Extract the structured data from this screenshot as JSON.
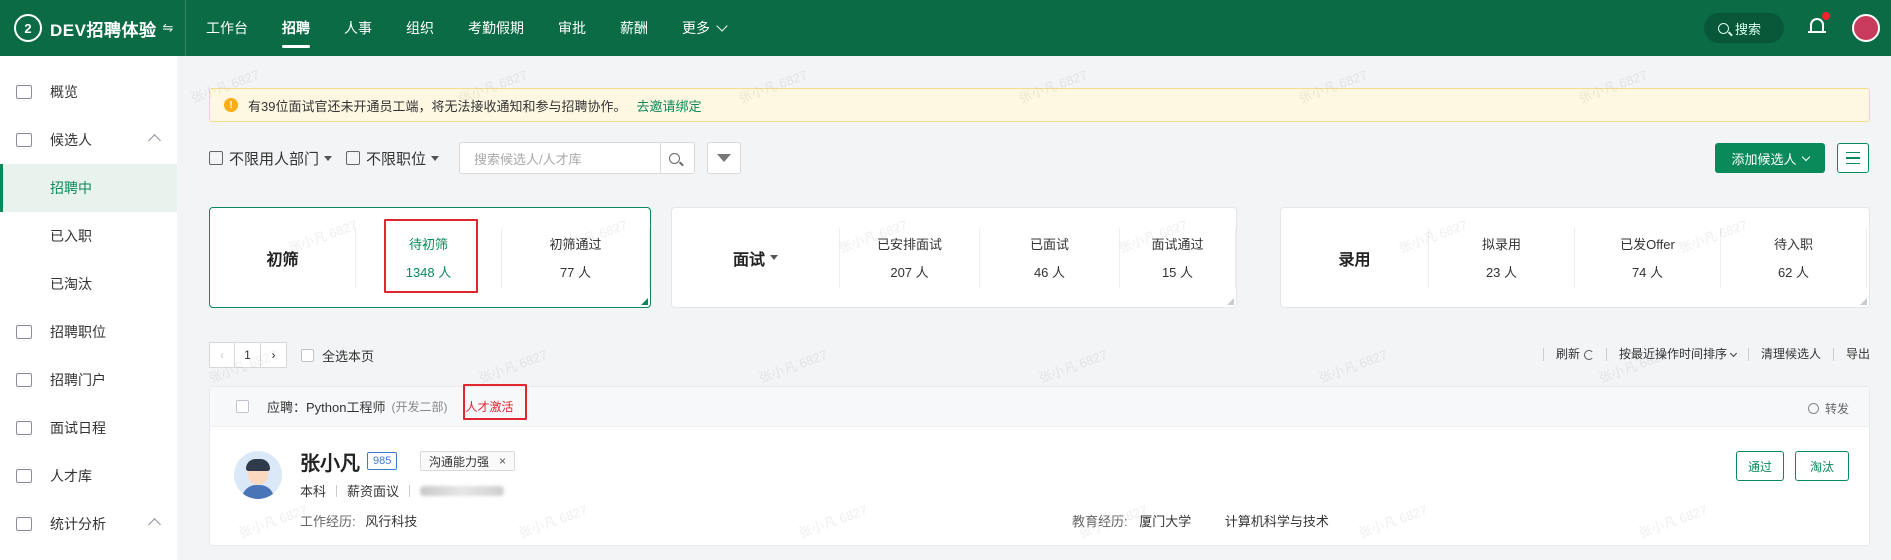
{
  "topbar": {
    "brand_logo": "2",
    "brand_name": "DEV招聘体验",
    "brand_switch_icon": "switch-icon",
    "nav": [
      "工作台",
      "招聘",
      "人事",
      "组织",
      "考勤假期",
      "审批",
      "薪酬",
      "更多"
    ],
    "active_nav": "招聘",
    "search_label": "搜索",
    "accent_color": "#0a6b45"
  },
  "sidebar": {
    "items": [
      {
        "label": "概览",
        "icon": "monitor-icon"
      },
      {
        "label": "候选人",
        "icon": "people-icon"
      },
      {
        "label": "招聘中",
        "icon": ""
      },
      {
        "label": "已入职",
        "icon": ""
      },
      {
        "label": "已淘汰",
        "icon": ""
      },
      {
        "label": "招聘职位",
        "icon": "briefcase-icon"
      },
      {
        "label": "招聘门户",
        "icon": "layout-icon"
      },
      {
        "label": "面试日程",
        "icon": "calendar-icon"
      },
      {
        "label": "人才库",
        "icon": "home-icon"
      },
      {
        "label": "统计分析",
        "icon": "bar-chart-icon"
      }
    ],
    "active": "招聘中"
  },
  "alert": {
    "text": "有39位面试官还未开通员工端，将无法接收通知和参与招聘协作。",
    "link": "去邀请绑定"
  },
  "filters": {
    "dept": "不限用人部门",
    "position": "不限职位",
    "search_placeholder": "搜索候选人/人才库"
  },
  "add_button": "添加候选人",
  "stages": {
    "screening": {
      "title": "初筛",
      "stats": [
        {
          "label": "待初筛",
          "value": "1348 人"
        },
        {
          "label": "初筛通过",
          "value": "77 人"
        }
      ]
    },
    "interview": {
      "title": "面试",
      "stats": [
        {
          "label": "已安排面试",
          "value": "207 人"
        },
        {
          "label": "已面试",
          "value": "46 人"
        },
        {
          "label": "面试通过",
          "value": "15 人"
        }
      ]
    },
    "hire": {
      "title": "录用",
      "stats": [
        {
          "label": "拟录用",
          "value": "23 人"
        },
        {
          "label": "已发Offer",
          "value": "74 人"
        },
        {
          "label": "待入职",
          "value": "62 人"
        }
      ]
    }
  },
  "pager": {
    "prev": "‹",
    "page": "1",
    "next": "›",
    "select_all": "全选本页"
  },
  "toolbar": {
    "refresh": "刷新",
    "sort": "按最近操作时间排序",
    "clean": "清理候选人",
    "export": "导出"
  },
  "candidate": {
    "applied_label": "应聘：",
    "applied_position": "Python工程师",
    "dept": "(开发二部)",
    "tag": "人才激活",
    "forward": "转发",
    "name": "张小凡",
    "badge": "985",
    "skill_tag": "沟通能力强",
    "degree": "本科",
    "salary": "薪资面议",
    "work_key": "工作经历:",
    "work_val": "风行科技",
    "edu_key": "教育经历:",
    "edu_school": "厦门大学",
    "edu_major": "计算机科学与技术",
    "pass_button": "通过",
    "reject_button": "淘汰"
  },
  "watermark": "张小凡 6827"
}
